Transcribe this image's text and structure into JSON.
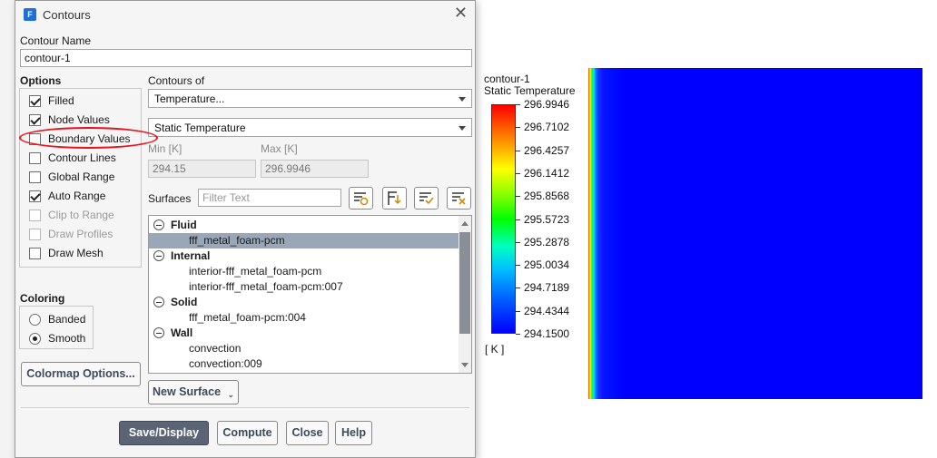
{
  "dialog": {
    "title": "Contours",
    "app_icon": "F",
    "contour_name_label": "Contour Name",
    "contour_name_value": "contour-1",
    "options_label": "Options",
    "options": [
      {
        "label": "Filled",
        "checked": true,
        "enabled": true
      },
      {
        "label": "Node Values",
        "checked": true,
        "enabled": true
      },
      {
        "label": "Boundary Values",
        "checked": false,
        "enabled": true
      },
      {
        "label": "Contour Lines",
        "checked": false,
        "enabled": true
      },
      {
        "label": "Global Range",
        "checked": false,
        "enabled": true
      },
      {
        "label": "Auto Range",
        "checked": true,
        "enabled": true
      },
      {
        "label": "Clip to Range",
        "checked": false,
        "enabled": false
      },
      {
        "label": "Draw Profiles",
        "checked": false,
        "enabled": false
      },
      {
        "label": "Draw Mesh",
        "checked": false,
        "enabled": true
      }
    ],
    "coloring_label": "Coloring",
    "coloring": [
      {
        "label": "Banded",
        "selected": false
      },
      {
        "label": "Smooth",
        "selected": true
      }
    ],
    "colormap_button": "Colormap Options...",
    "contours_of_label": "Contours of",
    "contours_of_value": "Temperature...",
    "contours_of_sub_value": "Static Temperature",
    "min_label": "Min [K]",
    "max_label": "Max [K]",
    "min_value": "294.15",
    "max_value": "296.9946",
    "surfaces_label": "Surfaces",
    "filter_placeholder": "Filter Text",
    "surfaces": [
      {
        "group": "Fluid",
        "items": [
          {
            "name": "fff_metal_foam-pcm",
            "selected": true
          }
        ]
      },
      {
        "group": "Internal",
        "items": [
          {
            "name": "interior-fff_metal_foam-pcm",
            "selected": false
          },
          {
            "name": "interior-fff_metal_foam-pcm:007",
            "selected": false
          }
        ]
      },
      {
        "group": "Solid",
        "items": [
          {
            "name": "fff_metal_foam-pcm:004",
            "selected": false
          }
        ]
      },
      {
        "group": "Wall",
        "items": [
          {
            "name": "convection",
            "selected": false
          },
          {
            "name": "convection:009",
            "selected": false
          }
        ]
      }
    ],
    "new_surface_button": "New Surface",
    "buttons": {
      "save_display": "Save/Display",
      "compute": "Compute",
      "close": "Close",
      "help": "Help"
    }
  },
  "plot": {
    "legend_title": "contour-1",
    "legend_subtitle": "Static Temperature",
    "tick_labels": [
      "296.9946",
      "296.7102",
      "296.4257",
      "296.1412",
      "295.8568",
      "295.5723",
      "295.2878",
      "295.0034",
      "294.7189",
      "294.4344",
      "294.1500"
    ],
    "unit": "[ K ]"
  },
  "colors": {
    "annotation": "#e8121d",
    "selection": "#9aa7b8",
    "primary_button": "#5a6474",
    "field_dominant": "#0000ff"
  }
}
